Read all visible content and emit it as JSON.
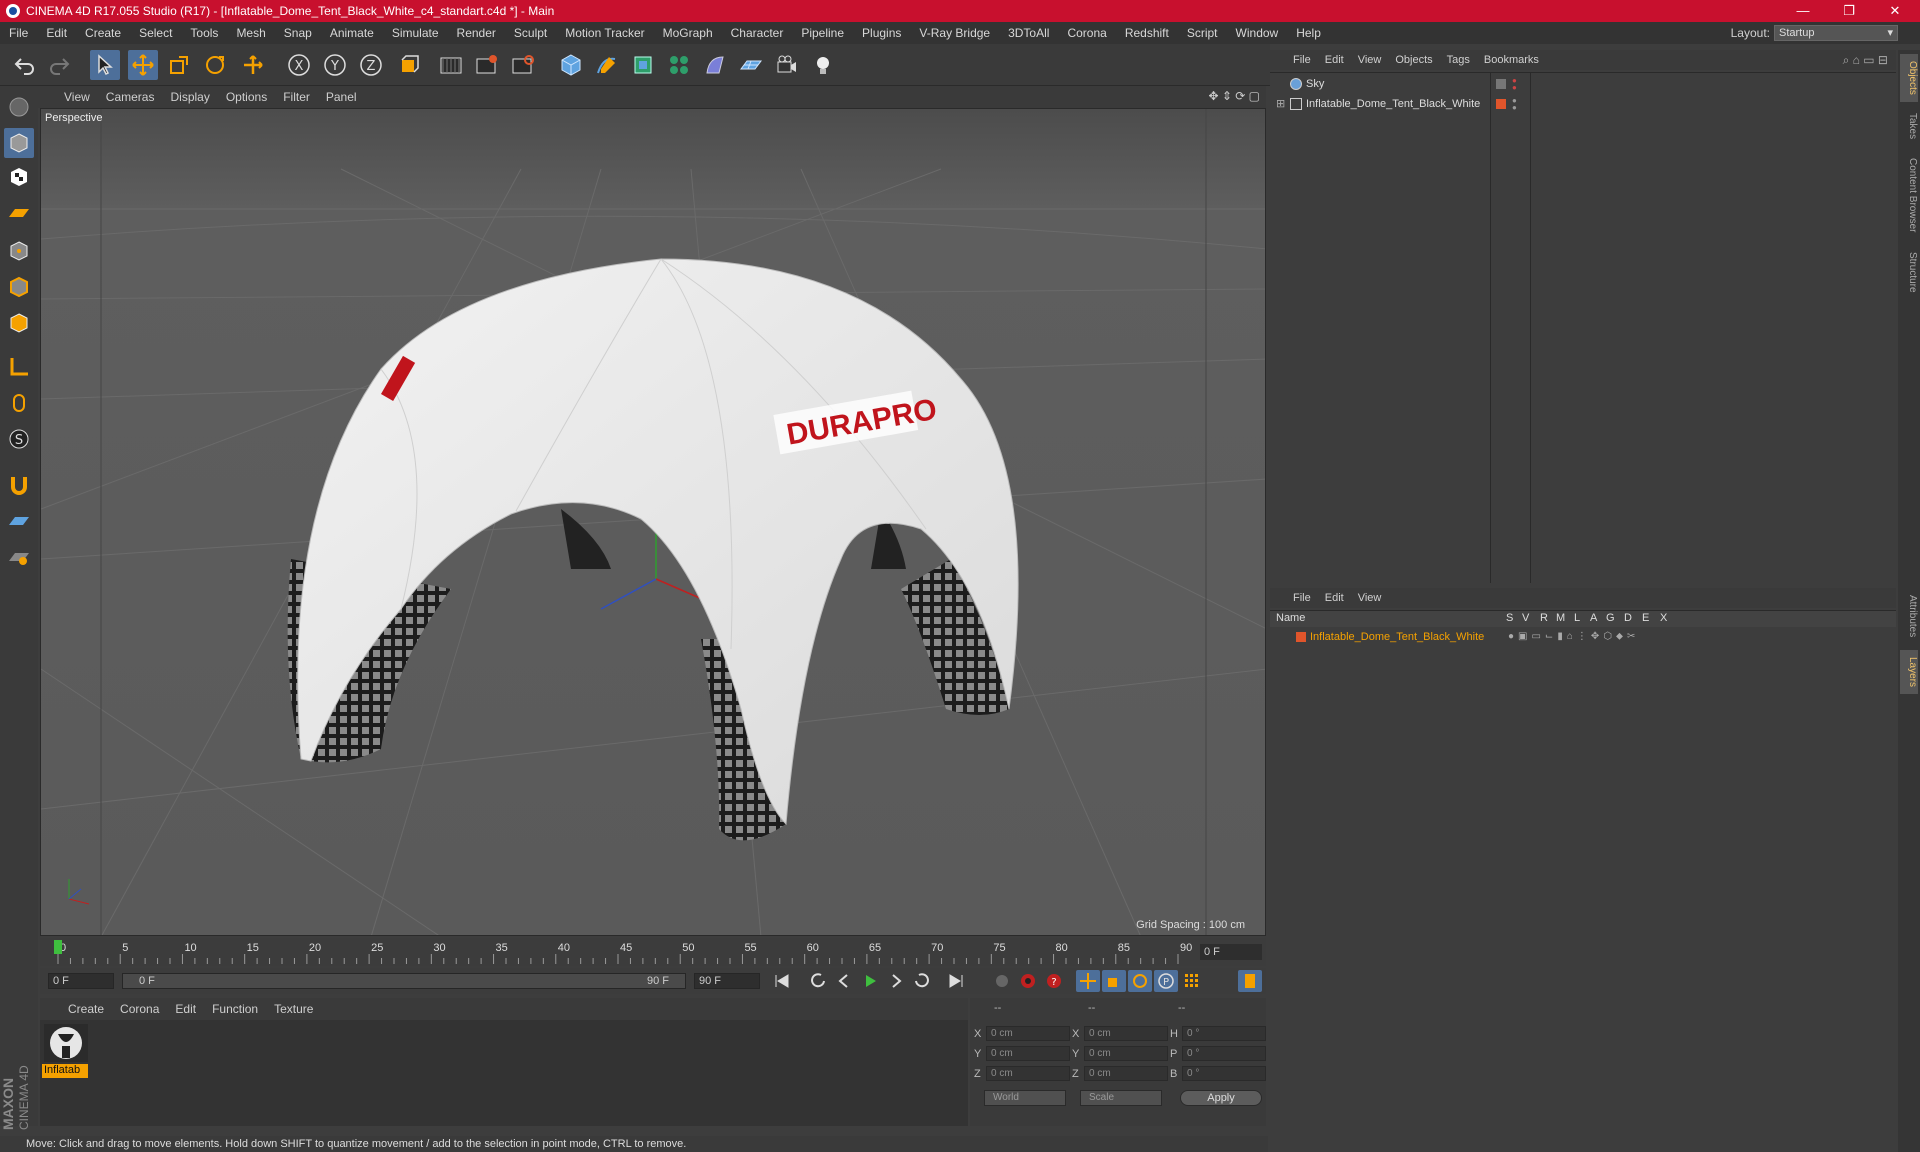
{
  "window": {
    "title": "CINEMA 4D R17.055 Studio (R17) - [Inflatable_Dome_Tent_Black_White_c4_standart.c4d *] - Main",
    "minimize": "—",
    "restore": "❐",
    "close": "✕"
  },
  "menubar": [
    "File",
    "Edit",
    "Create",
    "Select",
    "Tools",
    "Mesh",
    "Snap",
    "Animate",
    "Simulate",
    "Render",
    "Sculpt",
    "Motion Tracker",
    "MoGraph",
    "Character",
    "Pipeline",
    "Plugins",
    "V-Ray Bridge",
    "3DToAll",
    "Corona",
    "Redshift",
    "Script",
    "Window",
    "Help"
  ],
  "layout": {
    "label": "Layout:",
    "value": "Startup"
  },
  "toolbar": {
    "icons": [
      "undo-icon",
      "redo-icon",
      "select-icon",
      "move-icon",
      "scale-icon",
      "rotate-icon",
      "transform-icon",
      "x-axis-icon",
      "y-axis-icon",
      "z-axis-icon",
      "coordinate-system-icon",
      "render-view-icon",
      "render-picture-viewer-icon",
      "edit-render-settings-icon",
      "cube-icon",
      "pen-icon",
      "subdivision-icon",
      "cloner-icon",
      "deformer-icon",
      "floor-icon",
      "camera-icon",
      "light-icon"
    ],
    "x_label": "X",
    "y_label": "Y",
    "z_label": "Z"
  },
  "viewport": {
    "menu": [
      "View",
      "Cameras",
      "Display",
      "Options",
      "Filter",
      "Panel"
    ],
    "label": "Perspective",
    "grid_spacing": "Grid Spacing : 100 cm",
    "logo_text": "DURAPRO"
  },
  "timeline": {
    "ticks": [
      "0",
      "5",
      "10",
      "15",
      "20",
      "25",
      "30",
      "35",
      "40",
      "45",
      "50",
      "55",
      "60",
      "65",
      "70",
      "75",
      "80",
      "85",
      "90"
    ],
    "current_frame": "0 F",
    "end_frame_box": "0 F"
  },
  "transport": {
    "start": "0 F",
    "slider_start": "0 F",
    "slider_end": "90 F",
    "end": "90 F"
  },
  "material_manager": {
    "menu": [
      "Create",
      "Corona",
      "Edit",
      "Function",
      "Texture"
    ],
    "material_name": "Inflatab"
  },
  "coordinates": {
    "header_a": "--",
    "header_b": "--",
    "header_c": "--",
    "rows": [
      {
        "axis": "X",
        "pos": "0 cm",
        "axis2": "X",
        "size": "0 cm",
        "rot_label": "H",
        "rot": "0 °"
      },
      {
        "axis": "Y",
        "pos": "0 cm",
        "axis2": "Y",
        "size": "0 cm",
        "rot_label": "P",
        "rot": "0 °"
      },
      {
        "axis": "Z",
        "pos": "0 cm",
        "axis2": "Z",
        "size": "0 cm",
        "rot_label": "B",
        "rot": "0 °"
      }
    ],
    "world": "World",
    "scale": "Scale",
    "apply": "Apply"
  },
  "status": "Move: Click and drag to move elements. Hold down SHIFT to quantize movement / add to the selection in point mode, CTRL to remove.",
  "brand": {
    "line1": "MAXON",
    "line2": "CINEMA 4D"
  },
  "object_manager": {
    "menu": [
      "File",
      "Edit",
      "View",
      "Objects",
      "Tags",
      "Bookmarks"
    ],
    "objects": [
      {
        "name": "Sky"
      },
      {
        "name": "Inflatable_Dome_Tent_Black_White"
      }
    ]
  },
  "layer_manager": {
    "menu": [
      "File",
      "Edit",
      "View"
    ],
    "columns": [
      "Name",
      "S",
      "V",
      "R",
      "M",
      "L",
      "A",
      "G",
      "D",
      "E",
      "X"
    ],
    "layers": [
      {
        "name": "Inflatable_Dome_Tent_Black_White"
      }
    ]
  },
  "right_tabs": [
    "Objects",
    "Takes",
    "Content Browser",
    "Structure",
    "Attributes",
    "Layers"
  ],
  "colors": {
    "accent": "#f5a100",
    "title_bar": "#c8102e",
    "selection": "#4d6f9a",
    "layer_color": "#e0552b"
  }
}
